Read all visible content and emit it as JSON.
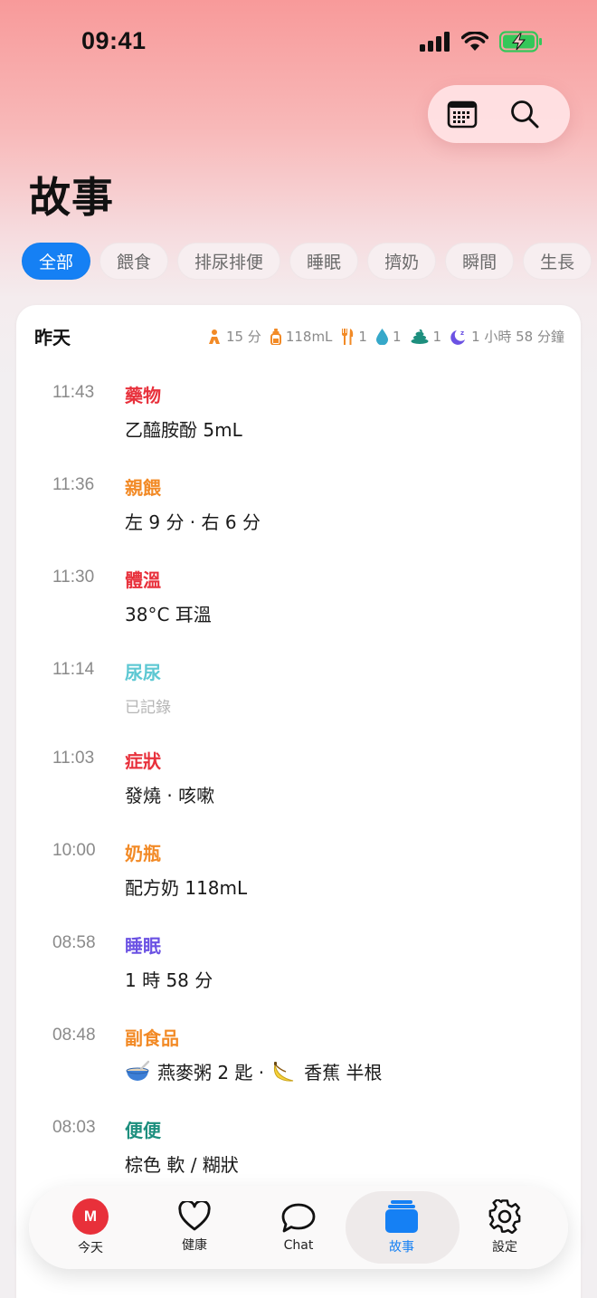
{
  "status_bar": {
    "time": "09:41"
  },
  "header": {
    "title": "故事"
  },
  "filters": [
    {
      "label": "全部",
      "active": true
    },
    {
      "label": "餵食"
    },
    {
      "label": "排尿排便"
    },
    {
      "label": "睡眠"
    },
    {
      "label": "擠奶"
    },
    {
      "label": "瞬間"
    },
    {
      "label": "生長"
    }
  ],
  "day": {
    "label": "昨天",
    "summary": [
      {
        "icon": "pump-icon",
        "text": "15 分",
        "color": "#f28a26"
      },
      {
        "icon": "bottle-icon",
        "text": "118mL",
        "color": "#f28a26"
      },
      {
        "icon": "utensils-icon",
        "text": "1",
        "color": "#f28a26"
      },
      {
        "icon": "droplet-icon",
        "text": "1",
        "color": "#36a8c9"
      },
      {
        "icon": "poop-icon",
        "text": "1",
        "color": "#1d8f7e"
      },
      {
        "icon": "moon-icon",
        "text": "1 小時 58 分鐘",
        "color": "#6b52e3"
      }
    ]
  },
  "entries": [
    {
      "time": "11:43",
      "type": "藥物",
      "color": "#e8313c",
      "detail": "乙醯胺酚 5mL"
    },
    {
      "time": "11:36",
      "type": "親餵",
      "color": "#f28a26",
      "detail": "左 9 分 · 右 6 分"
    },
    {
      "time": "11:30",
      "type": "體溫",
      "color": "#e8313c",
      "detail": "38°C 耳溫"
    },
    {
      "time": "11:14",
      "type": "尿尿",
      "color": "#5ec8d3",
      "detail": "已記錄",
      "muted": true
    },
    {
      "time": "11:03",
      "type": "症狀",
      "color": "#e8313c",
      "detail": "發燒 · 咳嗽"
    },
    {
      "time": "10:00",
      "type": "奶瓶",
      "color": "#f28a26",
      "detail": "配方奶 118mL"
    },
    {
      "time": "08:58",
      "type": "睡眠",
      "color": "#6b52e3",
      "detail": "1 時 58 分"
    },
    {
      "time": "08:48",
      "type": "副食品",
      "color": "#f28a26",
      "detail_parts": [
        "燕麥粥 2 匙 ·",
        "香蕉 半根"
      ],
      "icons": [
        "bowl-icon",
        "banana-icon"
      ]
    },
    {
      "time": "08:03",
      "type": "便便",
      "color": "#1d8f7e",
      "detail": "棕色 軟 / 糊狀"
    }
  ],
  "tabbar": {
    "items": [
      {
        "label": "今天",
        "icon": "avatar",
        "avatar_letter": "M"
      },
      {
        "label": "健康",
        "icon": "heart-icon"
      },
      {
        "label": "Chat",
        "icon": "chat-icon"
      },
      {
        "label": "故事",
        "icon": "stack-icon",
        "active": true
      },
      {
        "label": "設定",
        "icon": "gear-icon"
      }
    ],
    "accent": "#1580f4"
  }
}
